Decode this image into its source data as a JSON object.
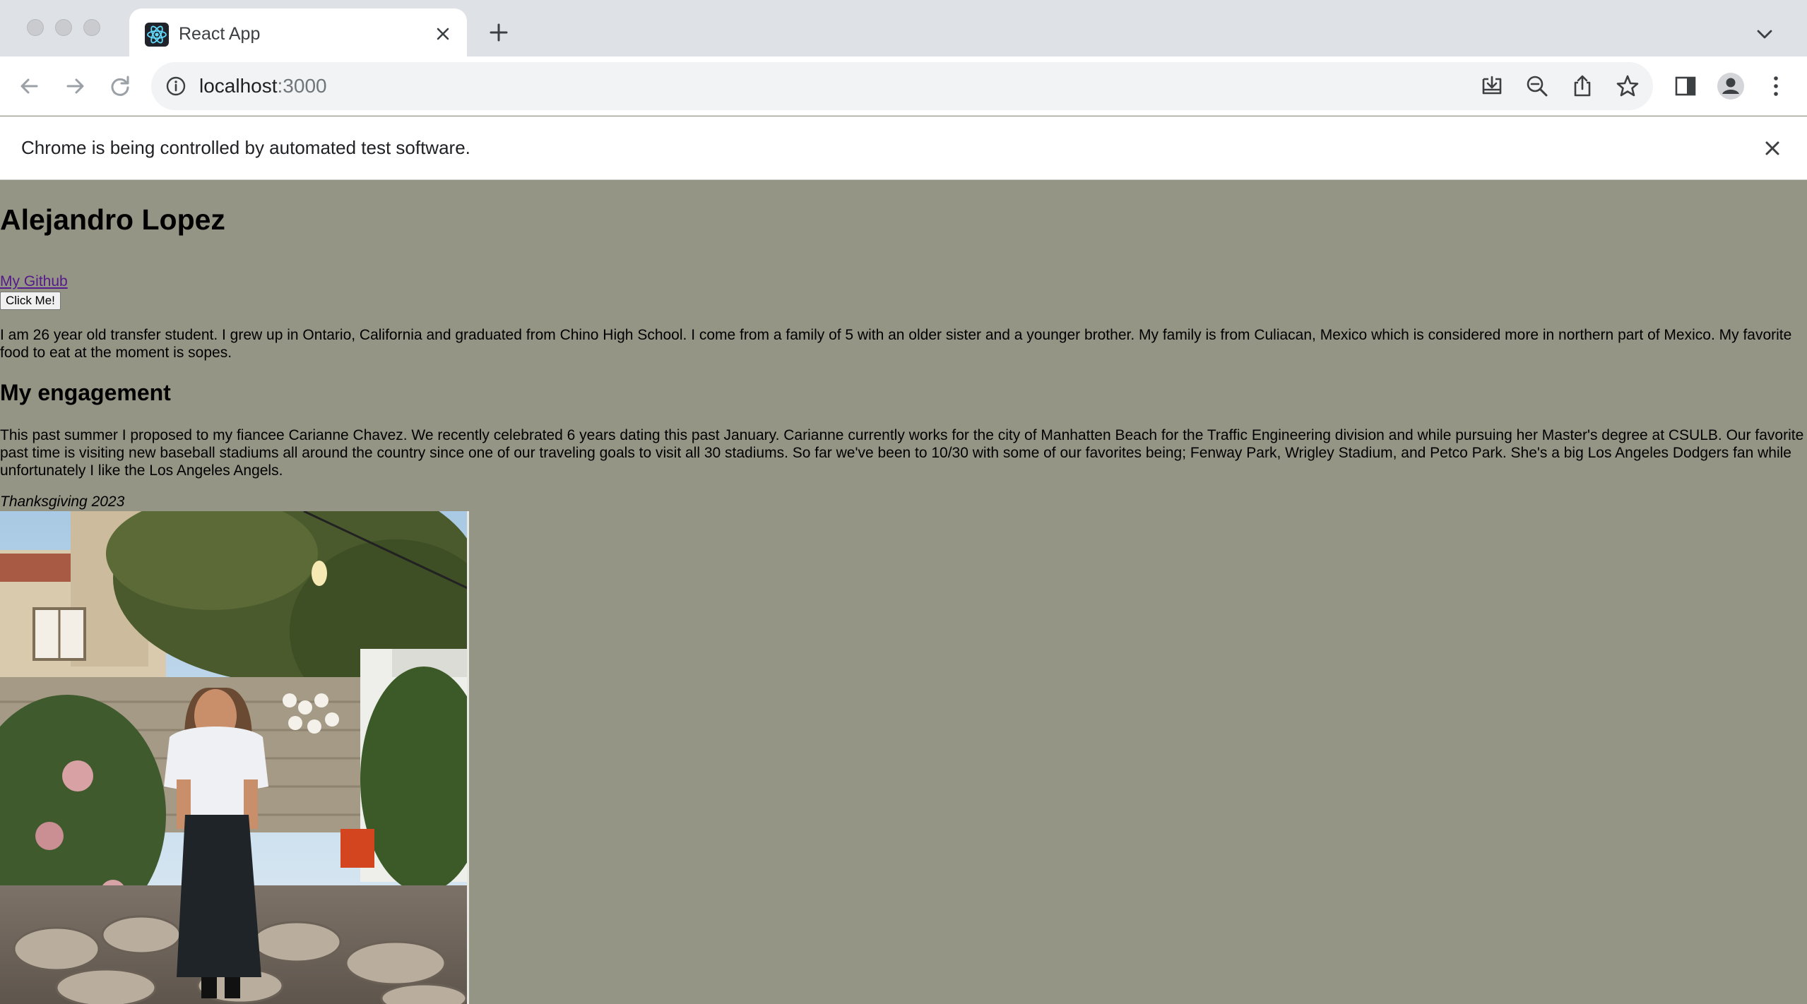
{
  "browser": {
    "tab_title": "React App",
    "url_host": "localhost",
    "url_port": ":3000",
    "infobar_message": "Chrome is being controlled by automated test software."
  },
  "page": {
    "heading": "Alejandro Lopez",
    "github_link": "My Github",
    "button_label": "Click Me!",
    "intro": "I am 26 year old transfer student. I grew up in Ontario, California and graduated from Chino High School. I come from a family of 5 with an older sister and a younger brother. My family is from Culiacan, Mexico which is considered more in northern part of Mexico. My favorite food to eat at the moment is sopes.",
    "section_heading": "My engagement",
    "engagement": "This past summer I proposed to my fiancee Carianne Chavez. We recently celebrated 6 years dating this past January. Carianne currently works for the city of Manhatten Beach for the Traffic Engineering division and while pursuing her Master's degree at CSULB. Our favorite past time is visiting new baseball stadiums all around the country since one of our traveling goals to visit all 30 stadiums. So far we've been to 10/30 with some of our favorites being; Fenway Park, Wrigley Stadium, and Petco Park. She's a big Los Angeles Dodgers fan while unfortunately I like the Los Angeles Angels.",
    "photo_caption": "Thanksgiving 2023"
  },
  "icons": {
    "favicon": "react-logo-icon",
    "back": "arrow-left-icon",
    "forward": "arrow-right-icon",
    "reload": "reload-icon",
    "info": "info-icon",
    "install": "install-icon",
    "zoom": "zoom-out-icon",
    "share": "share-icon",
    "bookmark": "star-icon",
    "sidepanel": "side-panel-icon",
    "profile": "profile-icon",
    "menu": "kebab-menu-icon"
  },
  "colors": {
    "page_background": "#959585",
    "link": "#551a8b",
    "react_blue": "#61dafb"
  }
}
